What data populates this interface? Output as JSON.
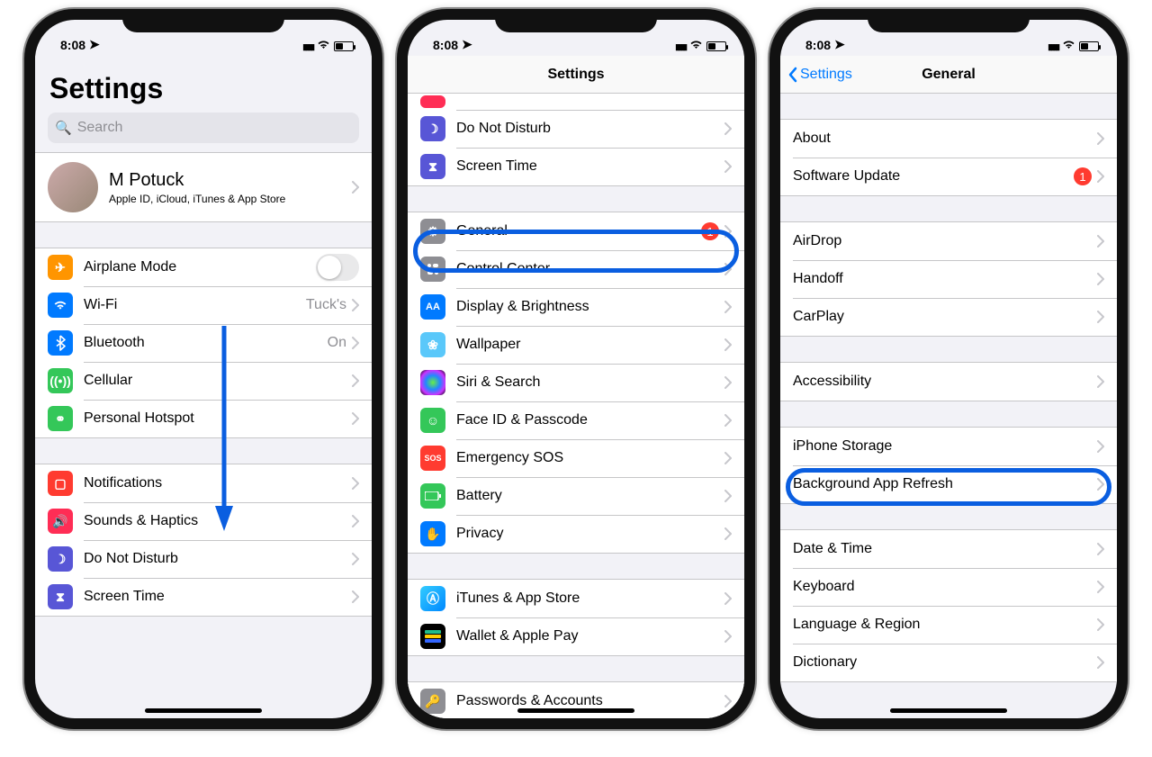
{
  "status_time": "8:08",
  "phone1": {
    "title": "Settings",
    "search_placeholder": "Search",
    "profile": {
      "name": "M Potuck",
      "sub": "Apple ID, iCloud, iTunes & App Store"
    },
    "g1": {
      "airplane": "Airplane Mode",
      "wifi": "Wi-Fi",
      "wifi_val": "Tuck's",
      "bluetooth": "Bluetooth",
      "bluetooth_val": "On",
      "cellular": "Cellular",
      "hotspot": "Personal Hotspot"
    },
    "g2": {
      "notifications": "Notifications",
      "sounds": "Sounds & Haptics",
      "dnd": "Do Not Disturb",
      "screen_time": "Screen Time"
    }
  },
  "phone2": {
    "nav_title": "Settings",
    "top": {
      "dnd": "Do Not Disturb",
      "screen_time": "Screen Time"
    },
    "mid": {
      "general": "General",
      "general_badge": "1",
      "control_center": "Control Center",
      "display": "Display & Brightness",
      "wallpaper": "Wallpaper",
      "siri": "Siri & Search",
      "faceid": "Face ID & Passcode",
      "sos": "Emergency SOS",
      "battery": "Battery",
      "privacy": "Privacy"
    },
    "bot": {
      "itunes": "iTunes & App Store",
      "wallet": "Wallet & Apple Pay"
    },
    "last": {
      "passwords": "Passwords & Accounts"
    }
  },
  "phone3": {
    "back": "Settings",
    "nav_title": "General",
    "g1": {
      "about": "About",
      "software": "Software Update",
      "software_badge": "1"
    },
    "g2": {
      "airdrop": "AirDrop",
      "handoff": "Handoff",
      "carplay": "CarPlay"
    },
    "g3": {
      "accessibility": "Accessibility"
    },
    "g4": {
      "storage": "iPhone Storage",
      "bgrefresh": "Background App Refresh"
    },
    "g5": {
      "datetime": "Date & Time",
      "keyboard": "Keyboard",
      "langregion": "Language & Region",
      "dictionary": "Dictionary"
    }
  }
}
